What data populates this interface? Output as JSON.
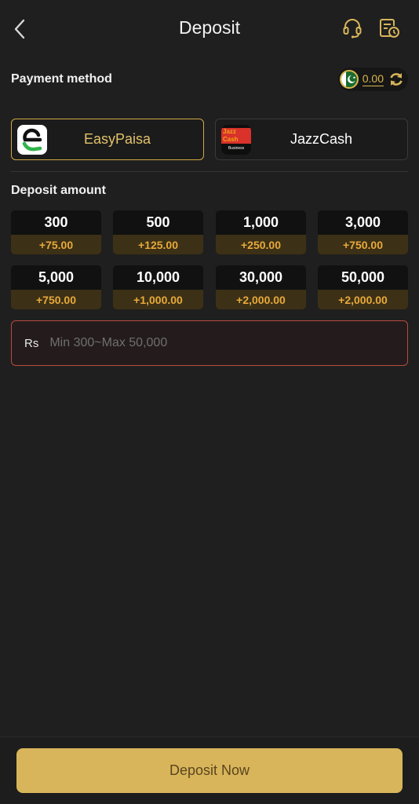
{
  "header": {
    "title": "Deposit",
    "back_icon": "chevron-left-icon",
    "support_icon": "headset-icon",
    "history_icon": "record-history-icon"
  },
  "payment": {
    "label": "Payment method",
    "balance": {
      "value": "0.00",
      "flag_icon": "pakistan-flag-icon",
      "refresh_icon": "refresh-icon"
    },
    "methods": [
      {
        "name": "EasyPaisa",
        "selected": true
      },
      {
        "name": "JazzCash",
        "selected": false,
        "logo_text": [
          "Jazz Cash",
          "Business"
        ]
      }
    ]
  },
  "deposit": {
    "label": "Deposit amount",
    "amounts": [
      {
        "value": "300",
        "bonus": "+75.00"
      },
      {
        "value": "500",
        "bonus": "+125.00"
      },
      {
        "value": "1,000",
        "bonus": "+250.00"
      },
      {
        "value": "3,000",
        "bonus": "+750.00"
      },
      {
        "value": "5,000",
        "bonus": "+750.00"
      },
      {
        "value": "10,000",
        "bonus": "+1,000.00"
      },
      {
        "value": "30,000",
        "bonus": "+2,000.00"
      },
      {
        "value": "50,000",
        "bonus": "+2,000.00"
      }
    ],
    "input": {
      "currency": "Rs",
      "placeholder": "Min 300~Max 50,000",
      "value": ""
    }
  },
  "footer": {
    "button_label": "Deposit Now"
  },
  "colors": {
    "accent": "#d8b55a",
    "bonus": "#e9a93a",
    "background": "#1f1f1f",
    "error_border": "#b84a40"
  }
}
